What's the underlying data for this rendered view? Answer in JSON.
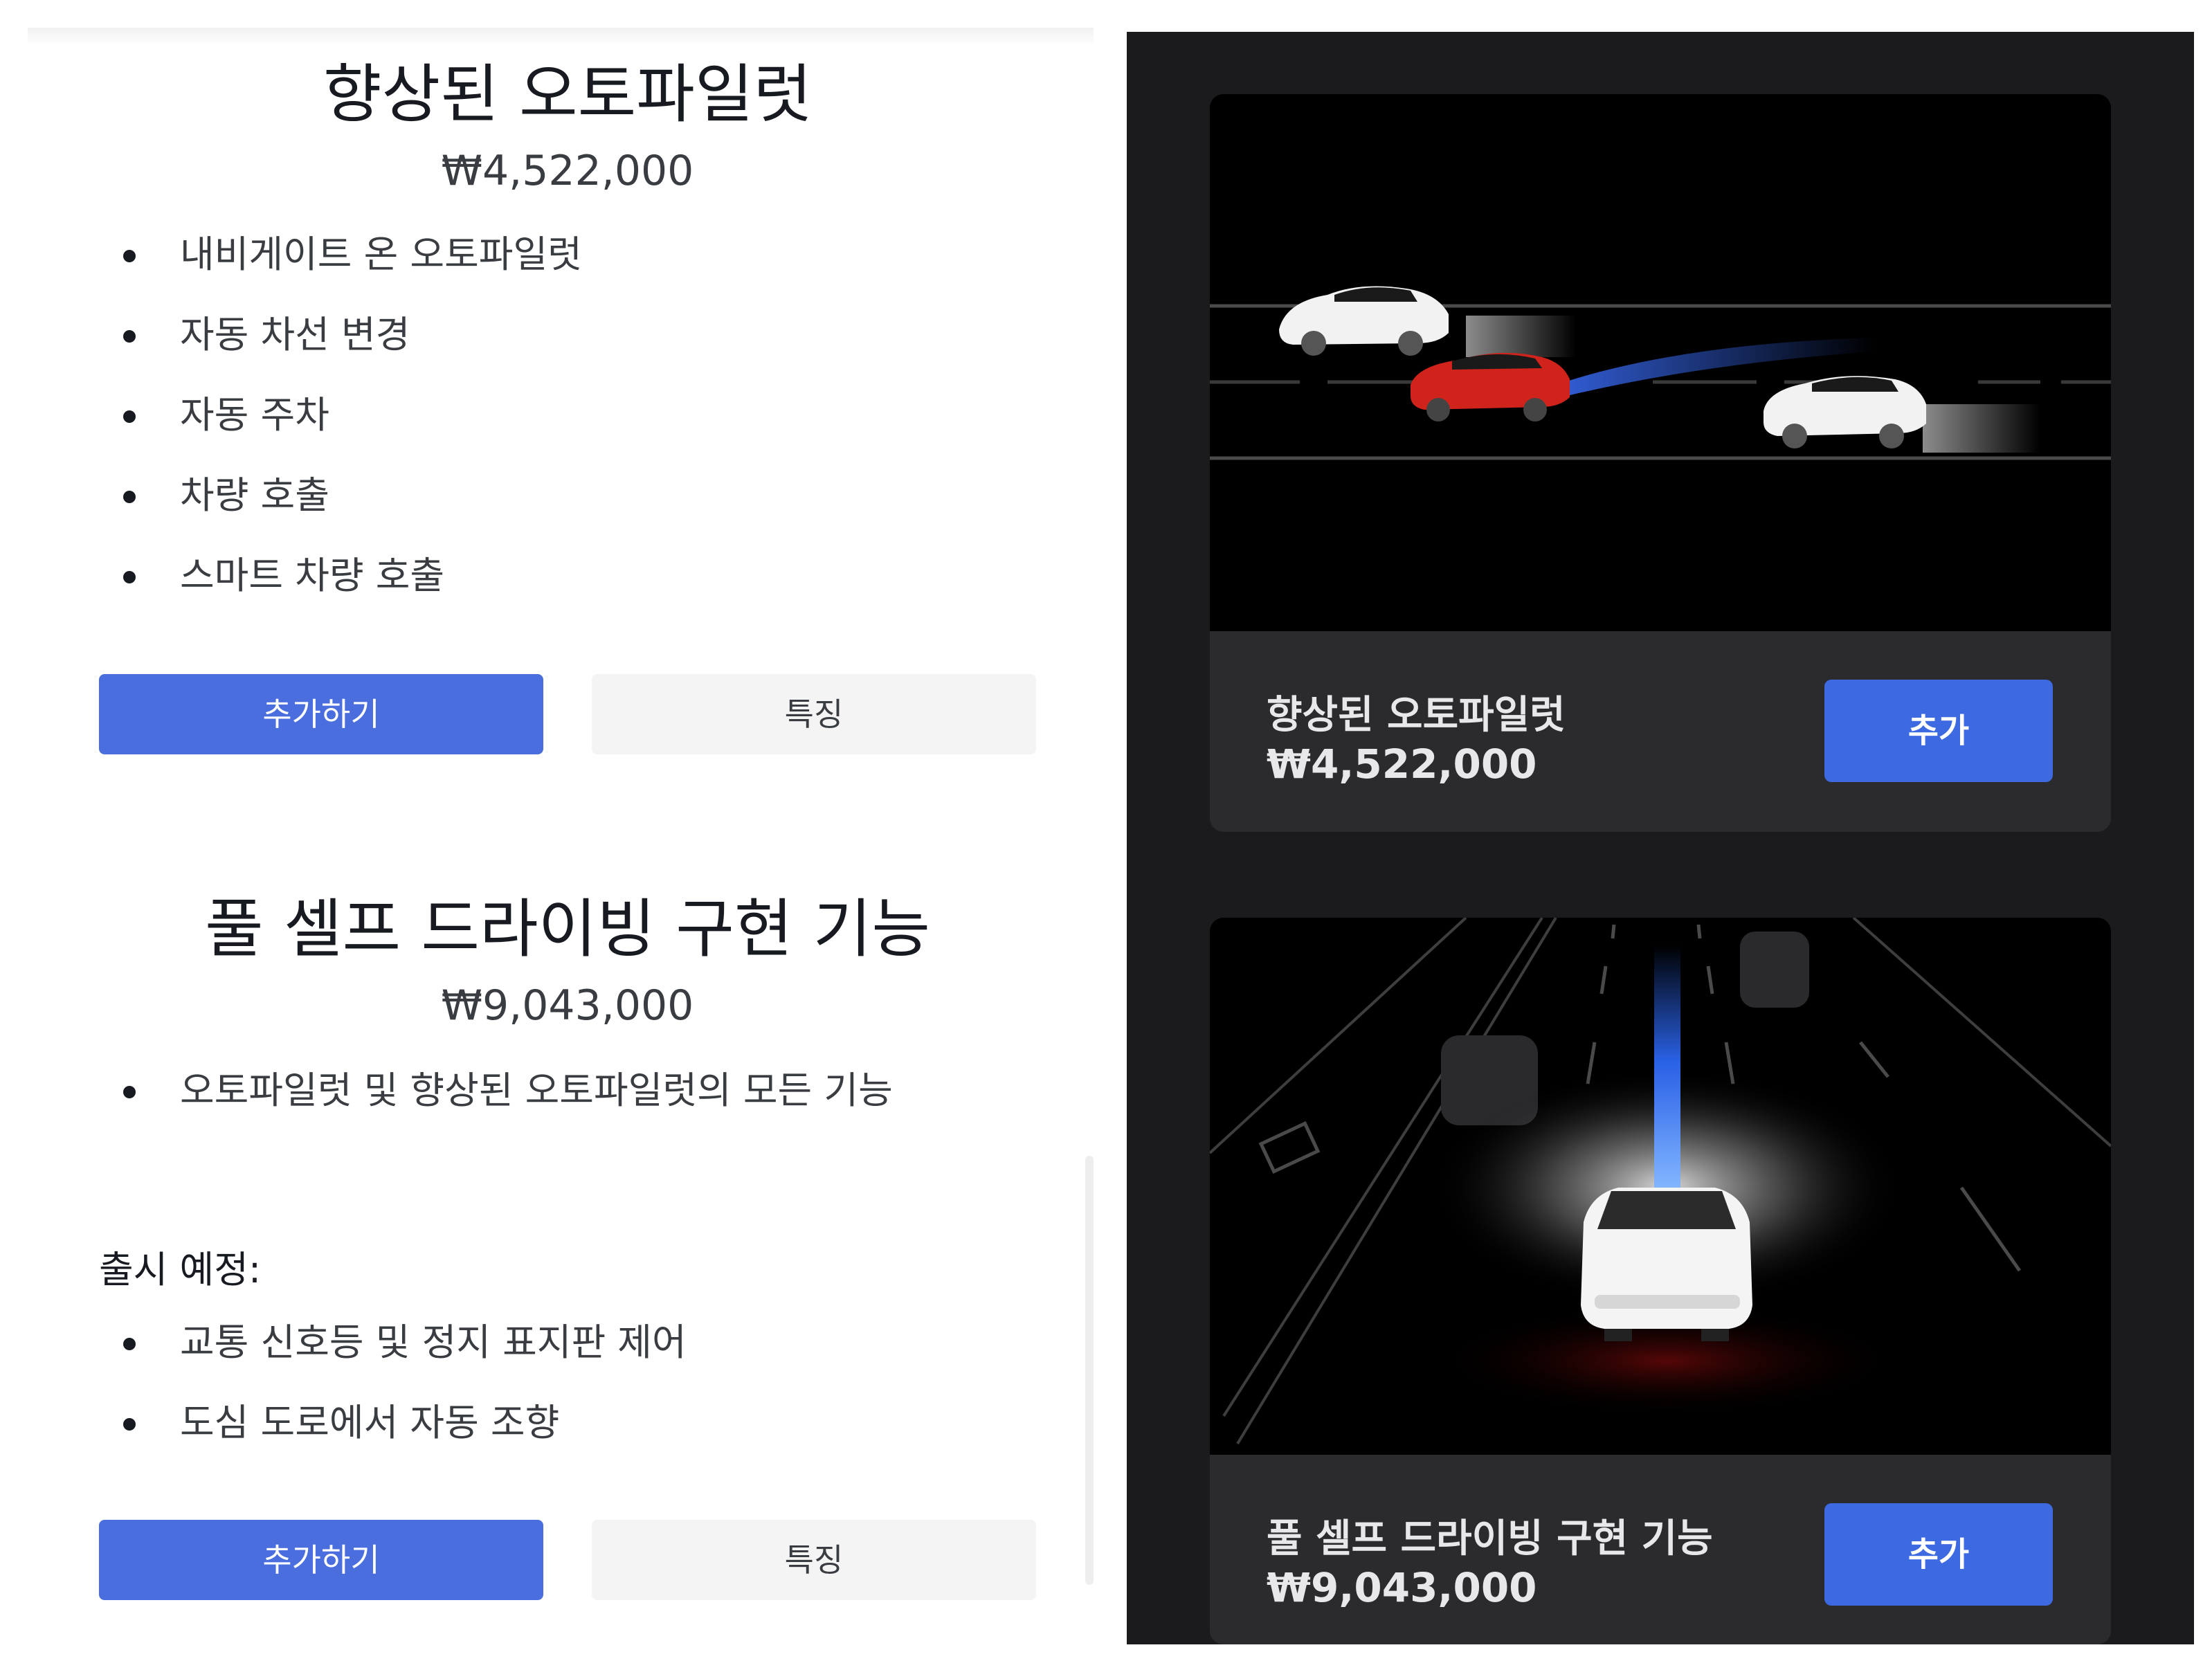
{
  "packages": [
    {
      "title": "향상된 오토파일럿",
      "price": "₩4,522,000",
      "features": [
        "내비게이트 온 오토파일럿",
        "자동 차선 변경",
        "자동 주차",
        "차량 호출",
        "스마트 차량 호출"
      ],
      "add_label": "추가하기",
      "features_label": "특징"
    },
    {
      "title": "풀 셀프 드라이빙 구현 기능",
      "price": "₩9,043,000",
      "features": [
        "오토파일럿 및 향상된 오토파일럿의 모든 기능"
      ],
      "upcoming_heading": "출시 예정:",
      "upcoming": [
        "교통 신호등 및 정지 표지판 제어",
        "도심 도로에서 자동 조향"
      ],
      "add_label": "추가하기",
      "features_label": "특징"
    }
  ],
  "cards": [
    {
      "title": "향상된 오토파일럿",
      "price": "₩4,522,000",
      "button": "추가",
      "image": "lane-change-illustration"
    },
    {
      "title": "풀 셀프 드라이빙 구현 기능",
      "price": "₩9,043,000",
      "button": "추가",
      "image": "highway-self-driving-illustration"
    }
  ],
  "colors": {
    "primary_button": "#4b6ede",
    "card_button": "#3e6ae1",
    "dark_background": "#1b1b1d",
    "card_background": "#2b2b2d"
  }
}
